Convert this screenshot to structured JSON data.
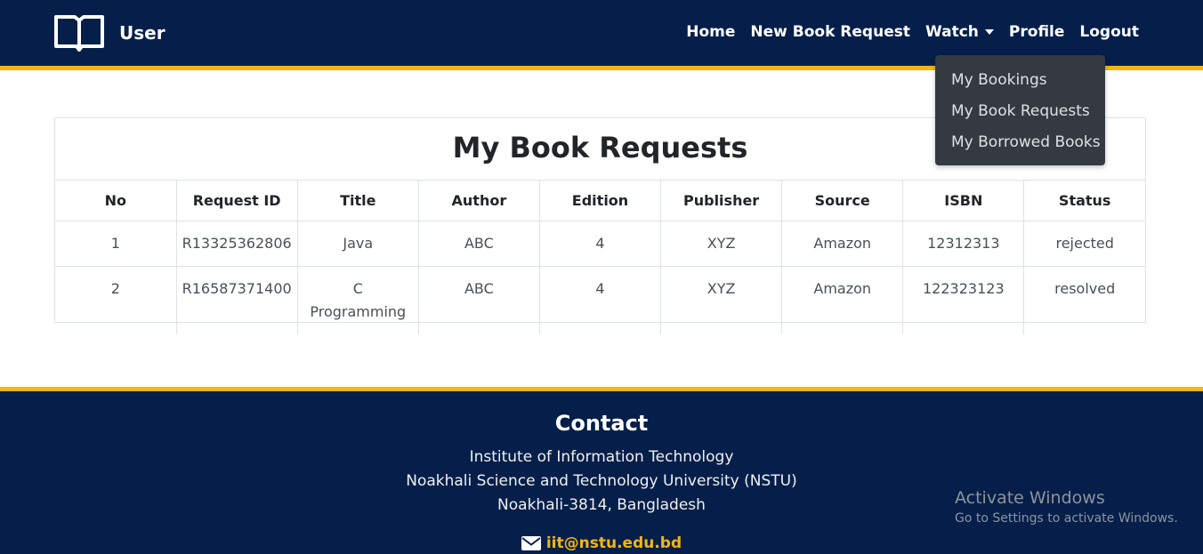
{
  "navbar": {
    "brand": "User",
    "links": [
      "Home",
      "New Book Request",
      "Watch",
      "Profile",
      "Logout"
    ],
    "dropdown_items": [
      "My Bookings",
      "My Book Requests",
      "My Borrowed Books"
    ]
  },
  "table": {
    "title": "My Book Requests",
    "headers": [
      "No",
      "Request ID",
      "Title",
      "Author",
      "Edition",
      "Publisher",
      "Source",
      "ISBN",
      "Status"
    ],
    "rows": [
      [
        "1",
        "R13325362806",
        "Java",
        "ABC",
        "4",
        "XYZ",
        "Amazon",
        "12312313",
        "rejected"
      ],
      [
        "2",
        "R16587371400",
        "C Programming",
        "ABC",
        "4",
        "XYZ",
        "Amazon",
        "122323123",
        "resolved"
      ]
    ]
  },
  "footer": {
    "title": "Contact",
    "address": [
      "Institute of Information Technology",
      "Noakhali Science and Technology University (NSTU)",
      "Noakhali-3814, Bangladesh"
    ],
    "email": "iit@nstu.edu.bd"
  },
  "watermark": {
    "title": "Activate Windows",
    "subtitle": "Go to Settings to activate Windows."
  },
  "colors": {
    "navy": "#051f4a",
    "accent": "#f6b50e",
    "dropdown_bg": "#343a40"
  },
  "icons": {
    "brand": "open-book-icon",
    "email": "envelope-icon",
    "watch_caret": "caret-down-icon"
  }
}
